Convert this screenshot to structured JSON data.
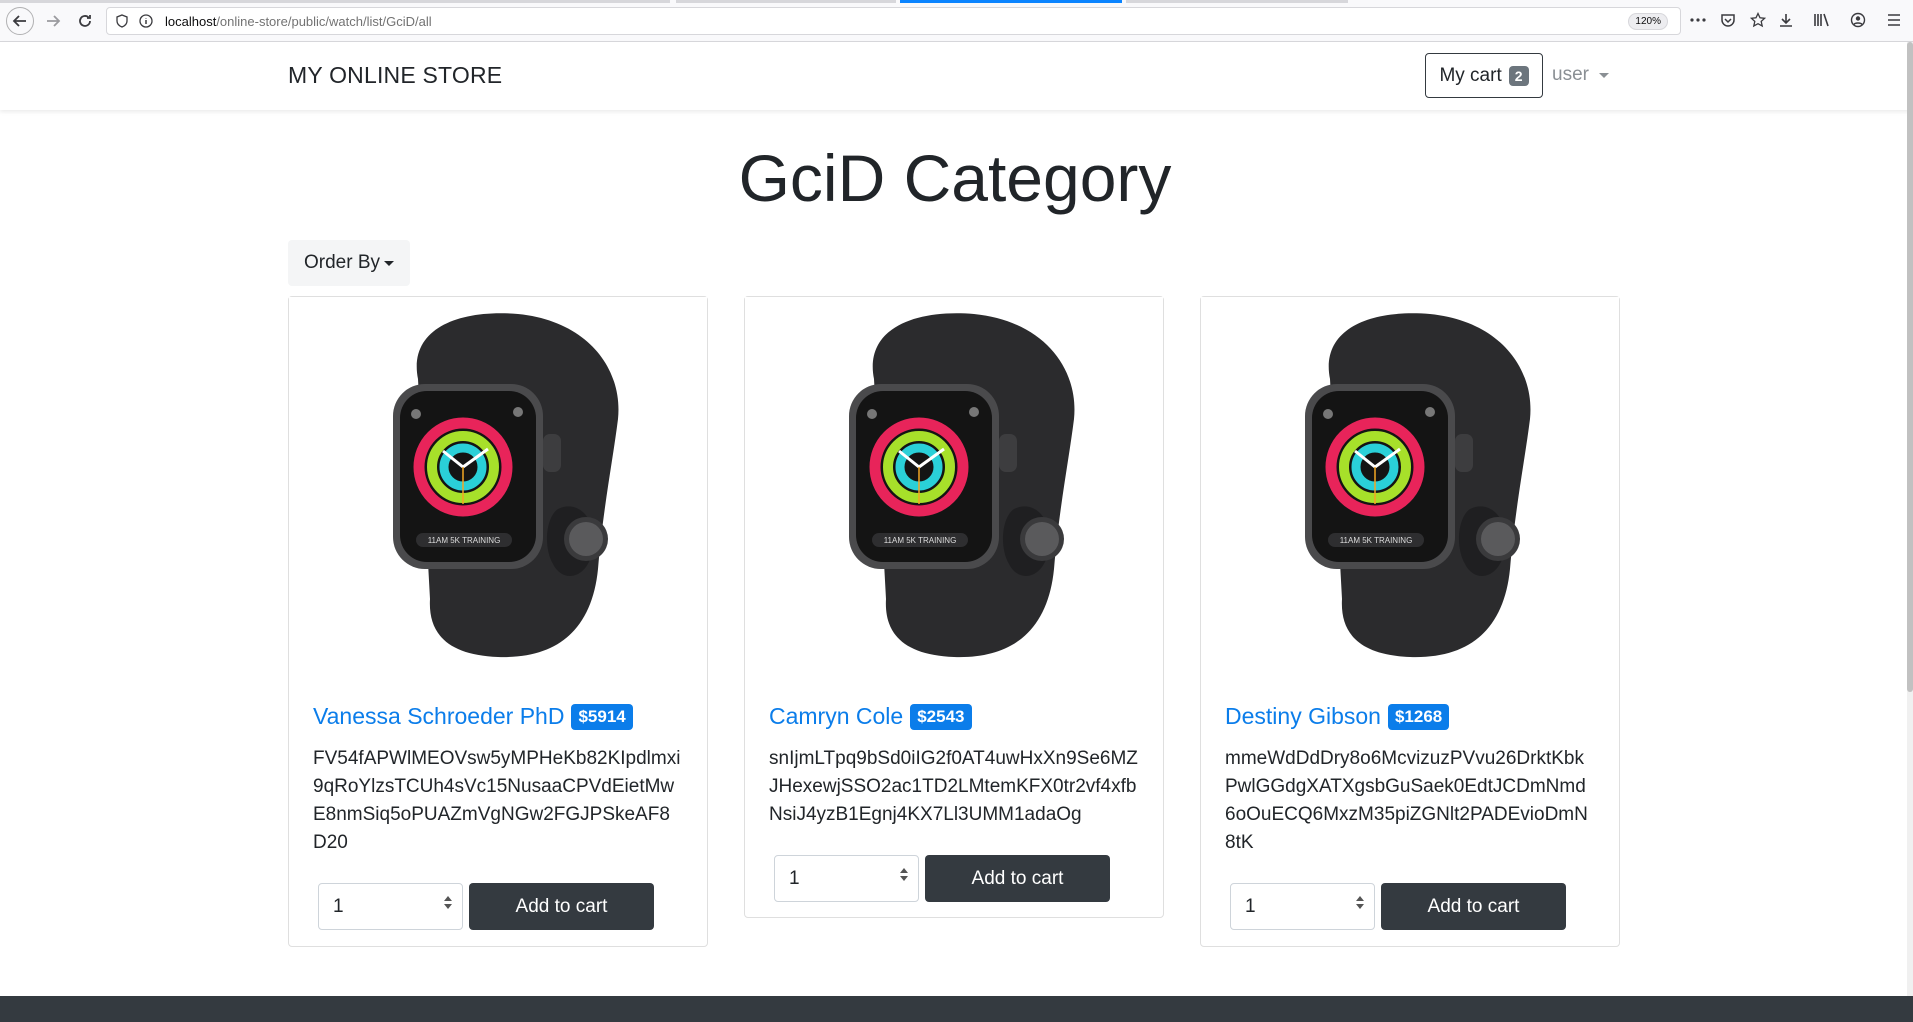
{
  "browser": {
    "url_host": "localhost",
    "url_path": "/online-store/public/watch/list/GciD/all",
    "zoom": "120%"
  },
  "navbar": {
    "brand": "MY ONLINE STORE",
    "cart_label": "My cart",
    "cart_count": "2",
    "user_label": "user"
  },
  "page": {
    "title": "GciD Category",
    "order_by_label": "Order By"
  },
  "products": [
    {
      "name": "Vanessa Schroeder PhD",
      "price": "$5914",
      "description": "FV54fAPWlMEOVsw5yMPHeKb82KIpdlmxi9qRoYlzsTCUh4sVc15NusaaCPVdEietMwE8nmSiq5oPUAZmVgNGw2FGJPSkeAF8D20",
      "quantity": "1",
      "add_label": "Add to cart"
    },
    {
      "name": "Camryn Cole",
      "price": "$2543",
      "description": "snIjmLTpq9bSd0iIG2f0AT4uwHxXn9Se6MZJHexewjSSO2ac1TD2LMtemKFX0tr2vf4xfbNsiJ4yzB1Egnj4KX7Ll3UMM1adaOg",
      "quantity": "1",
      "add_label": "Add to cart"
    },
    {
      "name": "Destiny Gibson",
      "price": "$1268",
      "description": "mmeWdDdDry8o6McvizuzPVvu26DrktKbkPwlGGdgXATXgsbGuSaek0EdtJCDmNmd6oOuECQ6MxzM35piZGNlt2PADEvioDmN8tK",
      "quantity": "1",
      "add_label": "Add to cart"
    }
  ],
  "colors": {
    "link": "#0b7dea",
    "dark": "#343a40",
    "badge_gray": "#6c757d"
  }
}
